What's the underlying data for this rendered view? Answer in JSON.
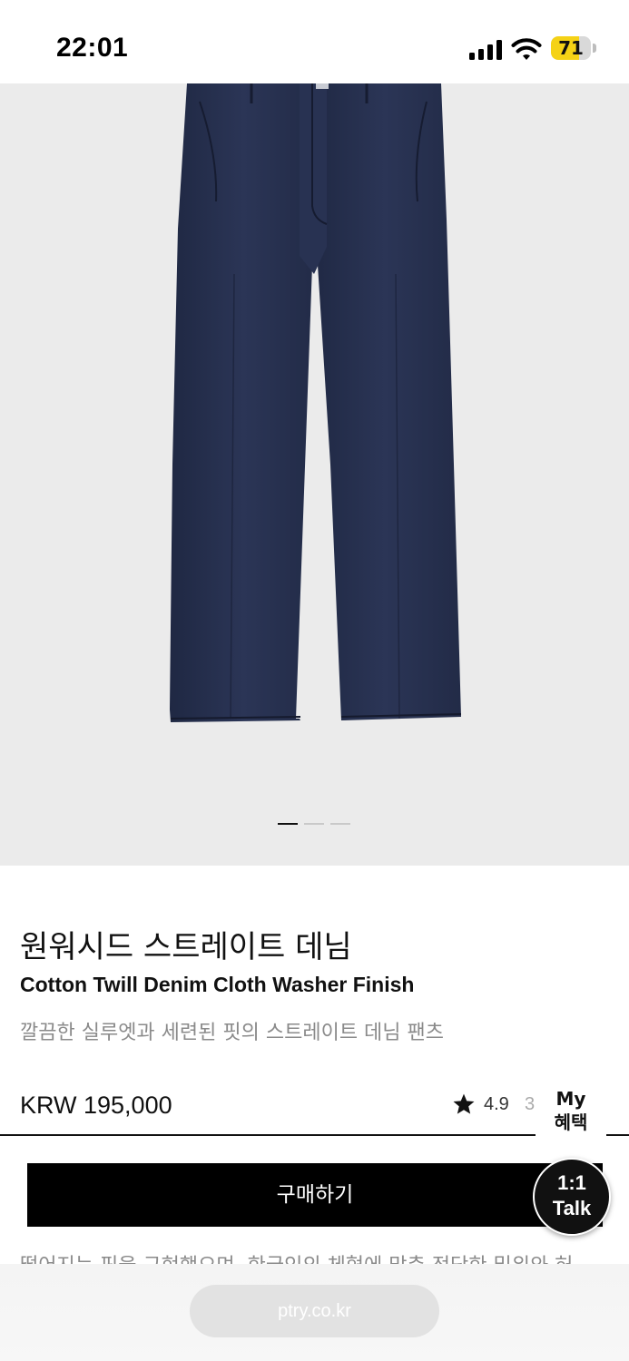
{
  "status_bar": {
    "time": "22:01",
    "battery": "71",
    "battery_level": 0.71,
    "icons": [
      "cellular-signal-icon",
      "wifi-icon",
      "battery-icon"
    ]
  },
  "product": {
    "image_alt": "denim-pants-photo",
    "carousel": {
      "count": 3,
      "active_index": 0
    },
    "title_ko": "원워시드 스트레이트 데님",
    "title_en": "Cotton Twill Denim Cloth Washer Finish",
    "description": "깔끔한 실루엣과 세련된 핏의 스트레이트 데님 팬츠",
    "price": "KRW 195,000",
    "rating": "4.9",
    "rating_extra": "3",
    "more_text": "떨어지는 핏을 구현했으며, 한국인의 체형에 맞춘 적당한 밑위와 허"
  },
  "floating": {
    "my_benefit_line1": "My",
    "my_benefit_line2": "혜택",
    "talk_line1": "1:1",
    "talk_line2": "Talk"
  },
  "actions": {
    "buy_label": "구매하기"
  },
  "browser": {
    "url": "ptry.co.kr"
  },
  "colors": {
    "accent": "#000000",
    "hero_background": "#ebebeb",
    "denim": "#262f4d",
    "battery_fill": "#f5d216",
    "muted_text": "#8a8a8a"
  }
}
